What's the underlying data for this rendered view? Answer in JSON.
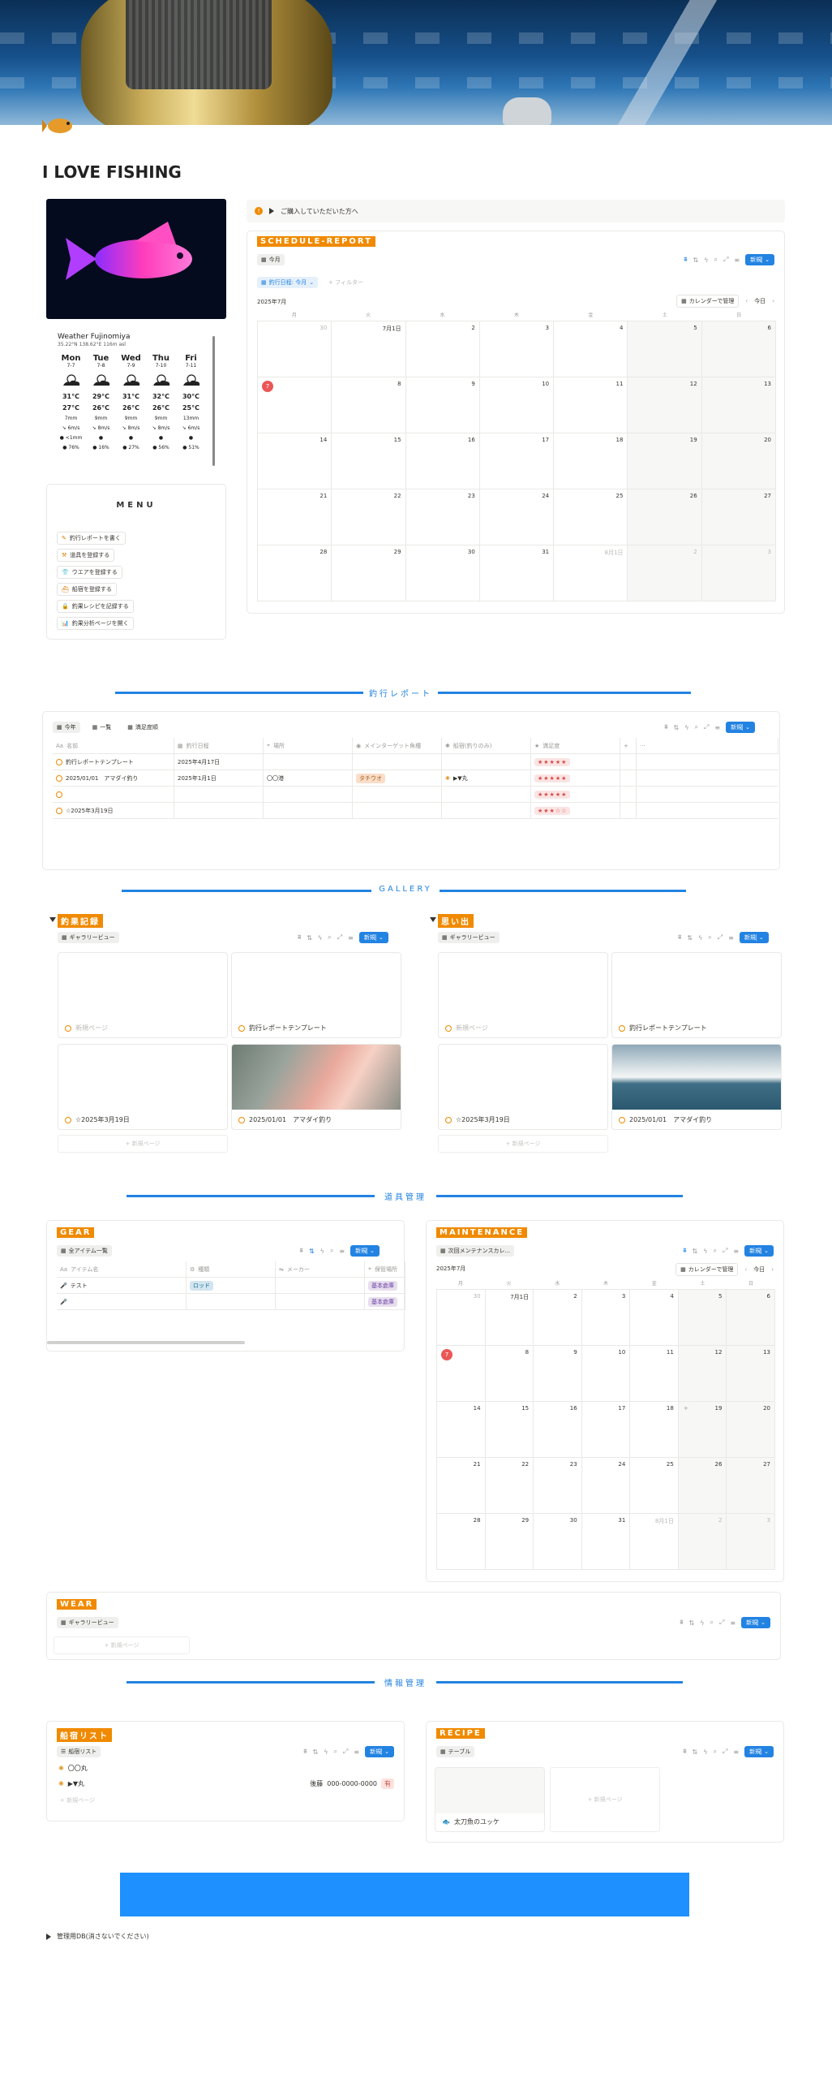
{
  "page": {
    "title": "I LOVE FISHING"
  },
  "callout": {
    "text": "ご購入していただいた方へ",
    "warn": "!"
  },
  "weather": {
    "title": "Weather Fujinomiya",
    "subtitle": "35.22°N 138.62°E 116m asl",
    "days": [
      {
        "day": "Mon",
        "date": "7-7",
        "hi": "31",
        "lo": "27",
        "rain": "7mm",
        "wind": "6m/s",
        "hum": "76%"
      },
      {
        "day": "Tue",
        "date": "7-8",
        "hi": "29",
        "lo": "26",
        "rain": "9mm",
        "wind": "8m/s",
        "hum": "16%"
      },
      {
        "day": "Wed",
        "date": "7-9",
        "hi": "31",
        "lo": "26",
        "rain": "9mm",
        "wind": "8m/s",
        "hum": "27%"
      },
      {
        "day": "Thu",
        "date": "7-10",
        "hi": "32",
        "lo": "26",
        "rain": "9mm",
        "wind": "8m/s",
        "hum": "56%"
      },
      {
        "day": "Fri",
        "date": "7-11",
        "hi": "30",
        "lo": "25",
        "rain": "13mm",
        "wind": "6m/s",
        "hum": "51%"
      }
    ],
    "deg": "°C",
    "first_wind": "<1mm"
  },
  "menu": {
    "title": "MENU",
    "items": [
      "釣行レポートを書く",
      "道具を登録する",
      "ウエアを登録する",
      "船宿を登録する",
      "釣果レシピを記録する",
      "釣果分析ページを開く"
    ]
  },
  "schedule": {
    "tag": "SCHEDULE-REPORT",
    "view": "今月",
    "filter_chip": "釣行日程: 今月",
    "filter_add": "+ フィルター",
    "month": "2025年7月",
    "manage": "カレンダーで管理",
    "today": "今日",
    "new": "新規",
    "dow": [
      "月",
      "火",
      "水",
      "木",
      "金",
      "土",
      "日"
    ],
    "days": [
      "30",
      "7月1日",
      "2",
      "3",
      "4",
      "5",
      "6",
      "7",
      "8",
      "9",
      "10",
      "11",
      "12",
      "13",
      "14",
      "15",
      "16",
      "17",
      "18",
      "19",
      "20",
      "21",
      "22",
      "23",
      "24",
      "25",
      "26",
      "27",
      "28",
      "29",
      "30",
      "31",
      "8月1日",
      "2",
      "3"
    ]
  },
  "sections": {
    "report": "釣行レポート",
    "gallery": "GALLERY",
    "gear": "道具管理",
    "info": "情報管理"
  },
  "report": {
    "views": [
      "今年",
      "一覧",
      "満足度順"
    ],
    "new": "新規",
    "headers": [
      "名前",
      "釣行日程",
      "場所",
      "メインターゲット魚種",
      "船宿(釣りのみ)",
      "満足度",
      "+",
      "···"
    ],
    "rows": [
      {
        "name": "釣行レポートテンプレート",
        "date": "2025年4月17日",
        "place": "",
        "target": "",
        "boat": "",
        "stars": "★★★★★"
      },
      {
        "name": "2025/01/01　アマダイ釣り",
        "date": "2025年1月1日",
        "place": "〇〇港",
        "target": "タチウオ",
        "boat": "▶▼丸",
        "stars": "★★★★★"
      },
      {
        "name": "",
        "date": "",
        "place": "",
        "target": "",
        "boat": "",
        "stars": "★★★★★"
      },
      {
        "name": "☆2025年3月19日",
        "date": "",
        "place": "",
        "target": "",
        "boat": "",
        "stars": "★★★☆☆"
      }
    ]
  },
  "gallery": {
    "left": {
      "tag": "釣果記録",
      "view": "ギャラリービュー",
      "new": "新規",
      "cards": [
        "新規ページ",
        "釣行レポートテンプレート",
        "☆2025年3月19日",
        "2025/01/01　アマダイ釣り"
      ],
      "add": "+ 新規ページ"
    },
    "right": {
      "tag": "思い出",
      "view": "ギャラリービュー",
      "new": "新規",
      "cards": [
        "新規ページ",
        "釣行レポートテンプレート",
        "☆2025年3月19日",
        "2025/01/01　アマダイ釣り"
      ],
      "add": "+ 新規ページ"
    }
  },
  "gear": {
    "tag": "GEAR",
    "view": "全アイテム一覧",
    "new": "新規",
    "headers": [
      "アイテム名",
      "種類",
      "メーカー",
      "保管場所"
    ],
    "rows": [
      {
        "name": "テスト",
        "type": "ロッド",
        "maker": "",
        "place": "基本倉庫"
      },
      {
        "name": "",
        "type": "",
        "maker": "",
        "place": "基本倉庫"
      }
    ]
  },
  "maintenance": {
    "tag": "MAINTENANCE",
    "view": "次回メンテナンスカレ...",
    "new": "新規",
    "month": "2025年7月",
    "manage": "カレンダーで管理",
    "today": "今日",
    "plus": "+"
  },
  "wear": {
    "tag": "WEAR",
    "view": "ギャラリービュー",
    "new": "新規",
    "add": "+ 新規ページ"
  },
  "boats": {
    "tag": "船宿リスト",
    "view": "船宿リスト",
    "new": "新規",
    "rows": [
      {
        "name": "〇〇丸",
        "area": "",
        "phone": "",
        "badge": ""
      },
      {
        "name": "▶▼丸",
        "area": "後藤",
        "phone": "000-0000-0000",
        "badge": "有"
      }
    ],
    "add": "+ 新規ページ"
  },
  "recipe": {
    "tag": "RECIPE",
    "view": "テーブル",
    "new": "新規",
    "cards": [
      "太刀魚のユッケ"
    ],
    "add": "+ 新規ページ"
  },
  "admin": {
    "label": "管理用DB(消さないでください)"
  },
  "colors": {
    "accent": "#2383e2",
    "orange": "#f08a00",
    "today": "#eb5757"
  }
}
